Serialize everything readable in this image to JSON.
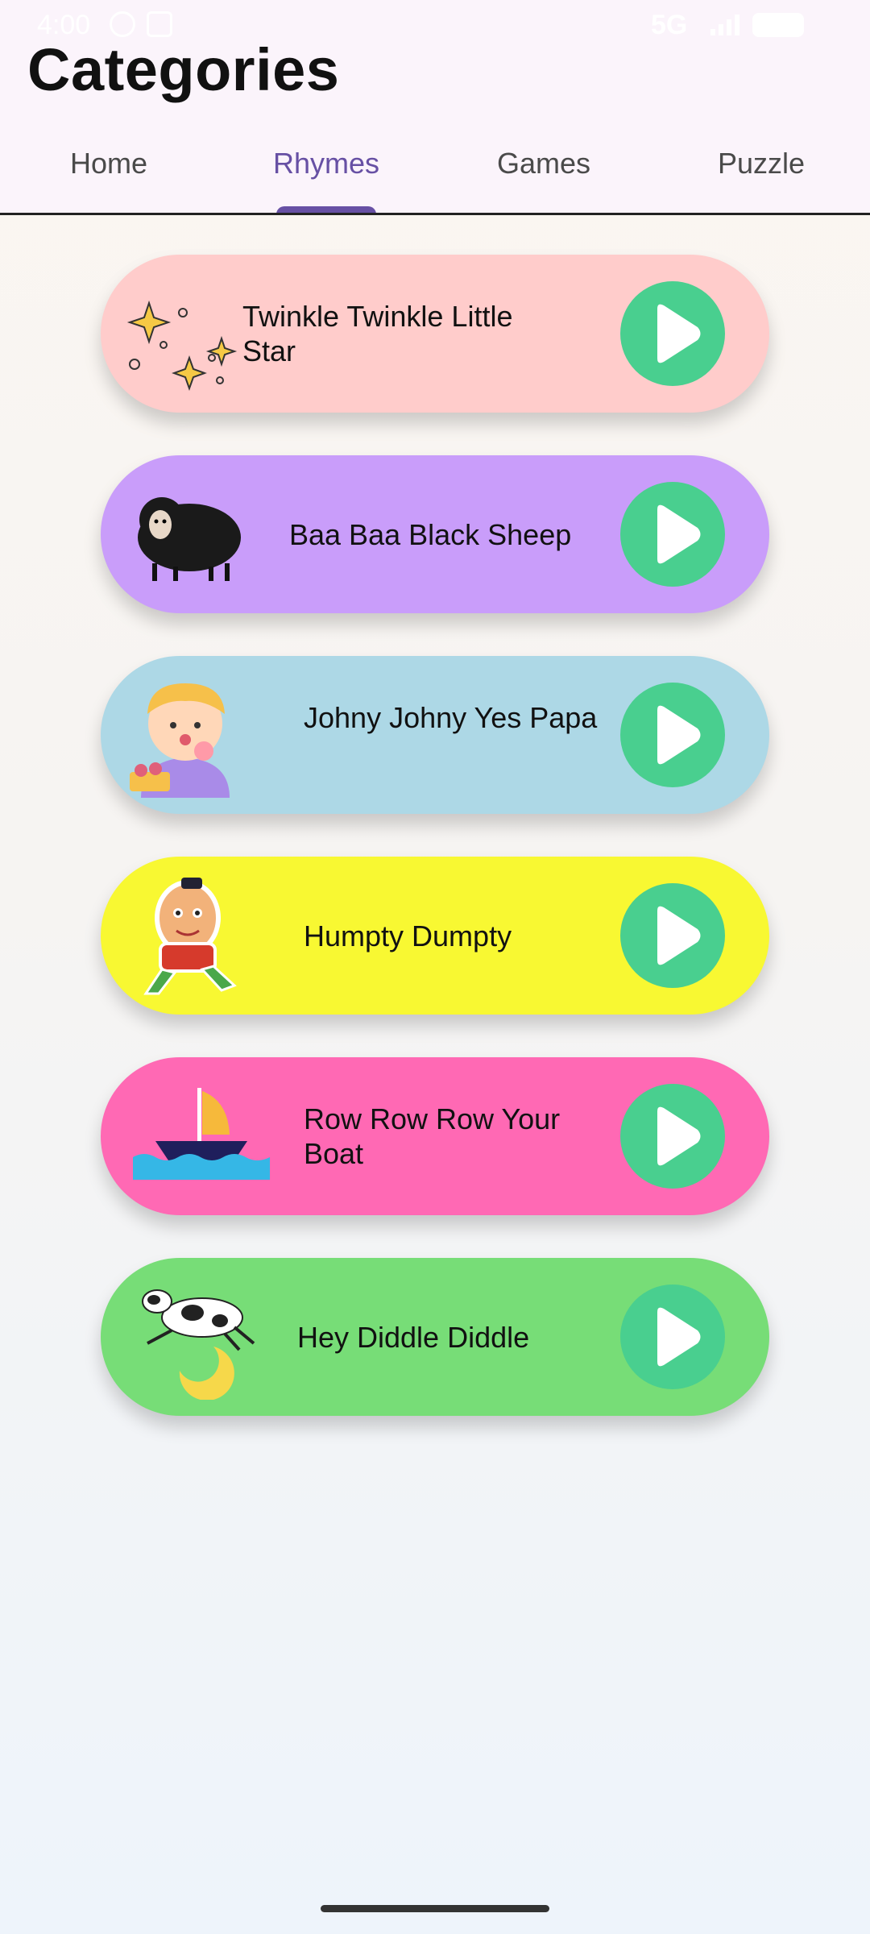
{
  "status": {
    "time": "4:00",
    "network": "5G"
  },
  "header": {
    "title": "Categories"
  },
  "tabs": [
    {
      "label": "Home"
    },
    {
      "label": "Rhymes",
      "active": true
    },
    {
      "label": "Games"
    },
    {
      "label": "Puzzle"
    }
  ],
  "rhymes": [
    {
      "title": "Twinkle Twinkle Little Star",
      "color": "#ffcccb",
      "icon": "stars-icon"
    },
    {
      "title": "Baa Baa Black Sheep",
      "color": "#c99dfa",
      "icon": "black-sheep-icon"
    },
    {
      "title": "Johny Johny Yes Papa",
      "color": "#add8e6",
      "icon": "boy-eating-icon"
    },
    {
      "title": "Humpty Dumpty",
      "color": "#f8f832",
      "icon": "humpty-dumpty-icon"
    },
    {
      "title": "Row Row Row Your Boat",
      "color": "#ff69b4",
      "icon": "sailboat-icon"
    },
    {
      "title": "Hey Diddle Diddle",
      "color": "#77dd77",
      "icon": "cow-moon-icon"
    }
  ],
  "colors": {
    "accent": "#6750a4",
    "play": "#49cf8f"
  }
}
